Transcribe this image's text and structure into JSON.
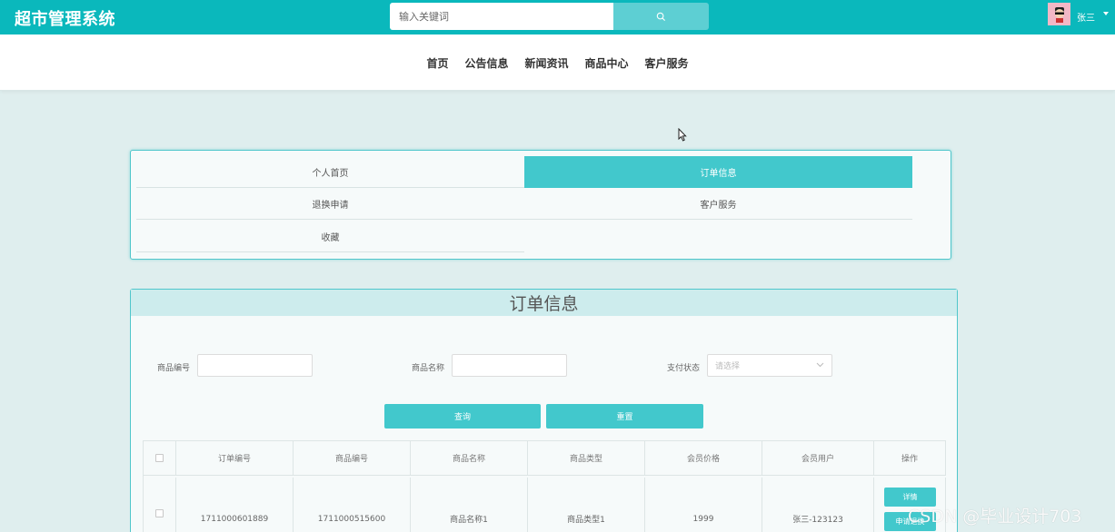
{
  "app": {
    "title": "超市管理系统"
  },
  "search": {
    "placeholder": "输入关键词"
  },
  "user": {
    "name": "张三"
  },
  "nav": {
    "items": [
      "首页",
      "公告信息",
      "新闻资讯",
      "商品中心",
      "客户服务"
    ]
  },
  "menu": {
    "items": [
      {
        "label": "个人首页",
        "active": false
      },
      {
        "label": "订单信息",
        "active": true
      },
      {
        "label": "退换申请",
        "active": false
      },
      {
        "label": "客户服务",
        "active": false
      },
      {
        "label": "收藏",
        "active": false
      }
    ]
  },
  "panel": {
    "title": "订单信息"
  },
  "filters": {
    "product_no_label": "商品编号",
    "product_name_label": "商品名称",
    "pay_status_label": "支付状态",
    "pay_status_placeholder": "请选择",
    "query_label": "查询",
    "reset_label": "重置"
  },
  "table": {
    "columns": [
      "订单编号",
      "商品编号",
      "商品名称",
      "商品类型",
      "会员价格",
      "会员用户",
      "操作"
    ],
    "rows": [
      {
        "order_no": "1711000601889",
        "product_no": "1711000515600",
        "product_name": "商品名称1",
        "product_type": "商品类型1",
        "price": "1999",
        "member": "张三-123123"
      }
    ],
    "detail_label": "详情",
    "apply_label": "申请退换"
  },
  "watermark": "CSDN @毕业设计703",
  "colors": {
    "primary": "#0ab8bc",
    "accent": "#42c8cc",
    "background": "#dfeeee"
  }
}
